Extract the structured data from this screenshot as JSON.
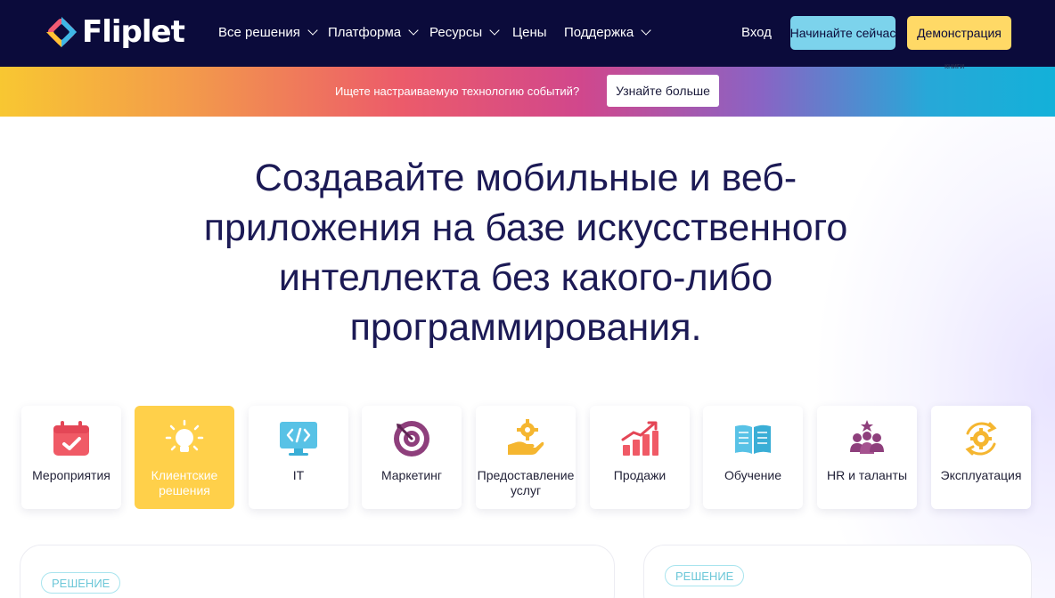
{
  "brand": {
    "name": "Fliplet"
  },
  "nav": {
    "items": [
      {
        "label": "Все решения",
        "has_dropdown": true
      },
      {
        "label": "Платформа",
        "has_dropdown": true
      },
      {
        "label": "Ресурсы",
        "has_dropdown": true
      },
      {
        "label": "Цены",
        "has_dropdown": false
      },
      {
        "label": "Поддержка",
        "has_dropdown": true
      }
    ],
    "login": "Вход",
    "start_button": "Начинайте сейчас",
    "demo_button": "Демонстрация",
    "demo_sub": "книги"
  },
  "banner": {
    "text": "Ищете настраиваемую технологию событий?",
    "button": "Узнайте больше"
  },
  "hero": {
    "title": "Создавайте мобильные и веб-приложения на базе искусственного интеллекта без какого-либо программирования."
  },
  "categories": [
    {
      "label": "Мероприятия",
      "icon": "calendar-icon"
    },
    {
      "label": "Клиентские решения",
      "icon": "lightbulb-icon",
      "active": true
    },
    {
      "label": "IT",
      "icon": "code-monitor-icon"
    },
    {
      "label": "Маркетинг",
      "icon": "target-icon"
    },
    {
      "label": "Предоставление услуг",
      "icon": "hand-gear-icon"
    },
    {
      "label": "Продажи",
      "icon": "growth-chart-icon"
    },
    {
      "label": "Обучение",
      "icon": "book-icon"
    },
    {
      "label": "HR и таланты",
      "icon": "team-icon"
    },
    {
      "label": "Эксплуатация",
      "icon": "gear-cycle-icon"
    }
  ],
  "solution_cards": [
    {
      "tag": "РЕШЕНИЕ"
    },
    {
      "tag": "РЕШЕНИЕ"
    }
  ],
  "colors": {
    "nav_bg": "#0b0b3b",
    "start_button": "#7cd3ec",
    "demo_button": "#ffd966",
    "active_card": "#ffd04a",
    "title": "#1c1a55"
  }
}
